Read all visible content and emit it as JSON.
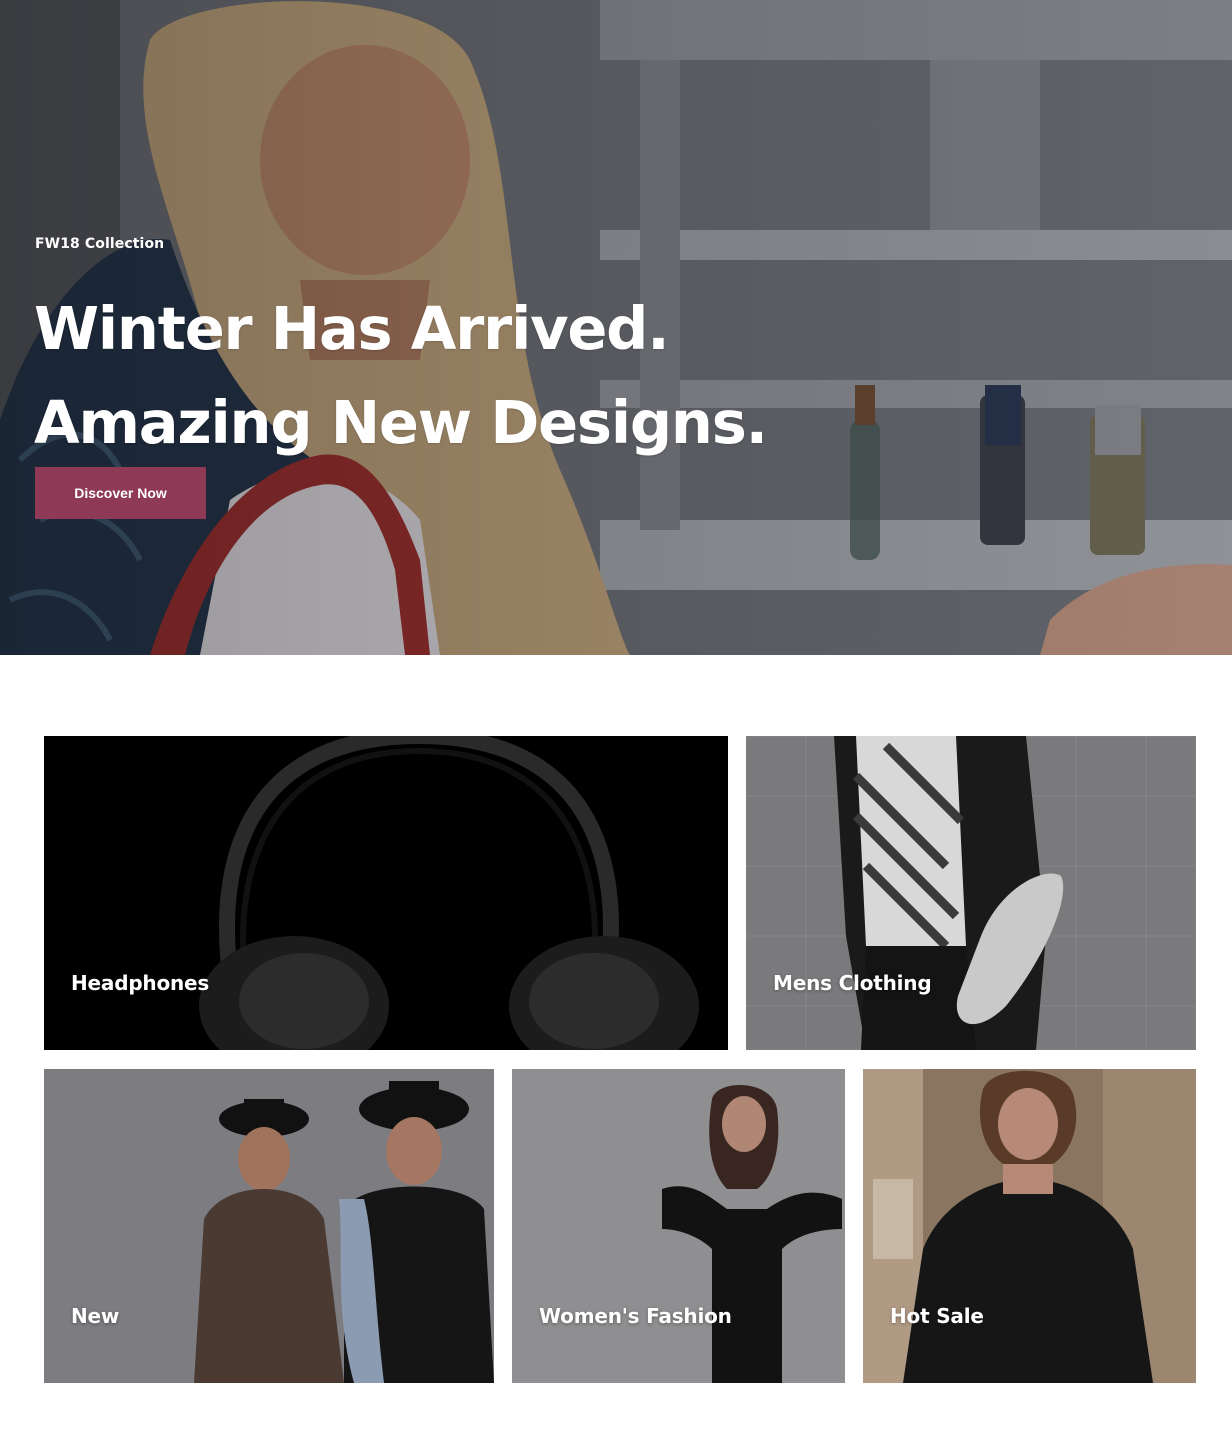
{
  "hero": {
    "eyebrow": "FW18 Collection",
    "title_line_1": "Winter Has Arrived.",
    "title_line_2": "Amazing New Designs.",
    "cta_label": "Discover Now",
    "cta_color": "#8e3a57"
  },
  "categories": [
    {
      "label": "Headphones"
    },
    {
      "label": "Mens Clothing"
    },
    {
      "label": "New"
    },
    {
      "label": "Women's Fashion"
    },
    {
      "label": "Hot Sale"
    }
  ]
}
